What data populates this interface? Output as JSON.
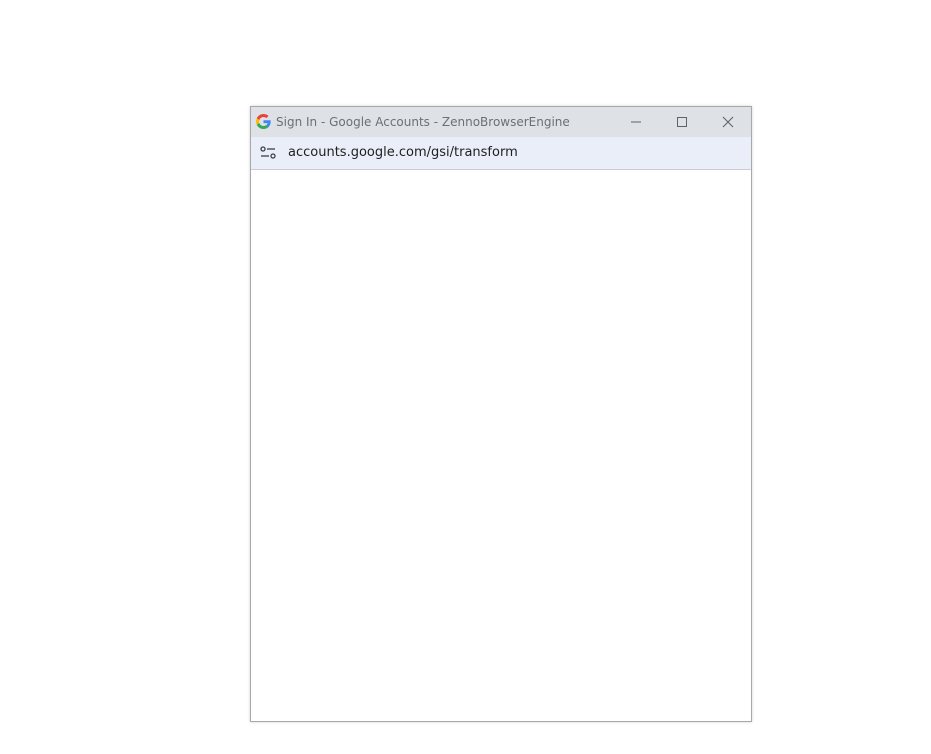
{
  "window": {
    "title": "Sign In - Google Accounts - ZennoBrowserEngine",
    "favicon": "google-g-icon",
    "controls": {
      "minimize": "minimize-icon",
      "maximize": "maximize-icon",
      "close": "close-icon"
    }
  },
  "addressbar": {
    "site_info_icon": "site-info-icon",
    "url": "accounts.google.com/gsi/transform"
  },
  "colors": {
    "titlebar": "#dee1e6",
    "addressbar": "#e9eef8",
    "google_blue": "#4285f4",
    "google_red": "#ea4335",
    "google_yellow": "#fbbc05",
    "google_green": "#34a853"
  }
}
